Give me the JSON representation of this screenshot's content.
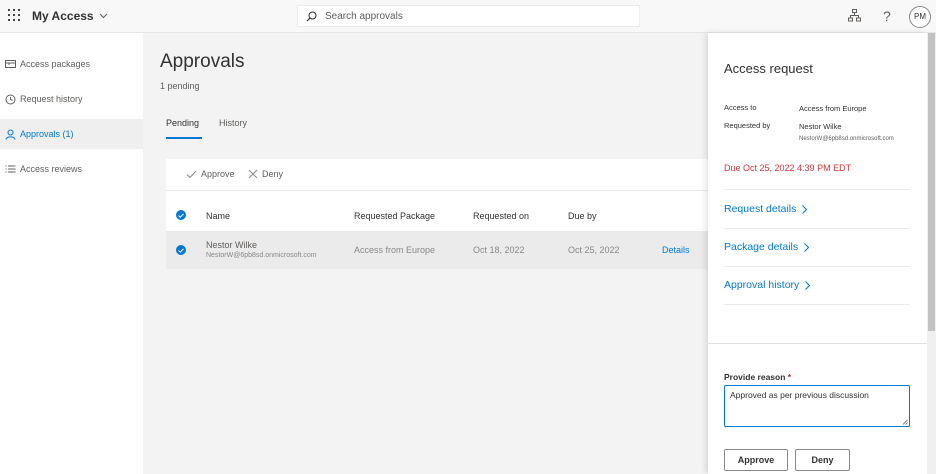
{
  "topbar": {
    "waffle_icon": "waffle-icon",
    "app_title": "My Access",
    "search_placeholder": "Search approvals",
    "org_icon": "org-chart-icon",
    "help_label": "?",
    "avatar_initials": "PM"
  },
  "sidebar": {
    "items": [
      {
        "label": "Access packages",
        "icon": "package-icon",
        "active": false
      },
      {
        "label": "Request history",
        "icon": "history-icon",
        "active": false
      },
      {
        "label": "Approvals (1)",
        "icon": "person-icon",
        "active": true
      },
      {
        "label": "Access reviews",
        "icon": "list-icon",
        "active": false
      }
    ]
  },
  "main": {
    "title": "Approvals",
    "subtitle": "1 pending",
    "tabs": [
      {
        "label": "Pending",
        "active": true
      },
      {
        "label": "History",
        "active": false
      }
    ],
    "commands": {
      "approve": "Approve",
      "deny": "Deny"
    },
    "columns": [
      "Name",
      "Requested Package",
      "Requested on",
      "Due by"
    ],
    "rows": [
      {
        "name": "Nestor Wilke",
        "email": "NestorW@6pb8sd.onmicrosoft.com",
        "package": "Access from Europe",
        "requested_on": "Oct 18, 2022",
        "due_by": "Oct 25, 2022",
        "action": "Details",
        "selected": true
      }
    ]
  },
  "panel": {
    "title": "Access request",
    "access_to_label": "Access to",
    "access_to_value": "Access from Europe",
    "requested_by_label": "Requested by",
    "requested_by_name": "Nestor Wilke",
    "requested_by_email": "NestorW@6pb8sd.onmicrosoft.com",
    "due": "Due Oct 25, 2022 4:39 PM EDT",
    "links": [
      "Request details",
      "Package details",
      "Approval history"
    ],
    "reason_label": "Provide reason",
    "reason_required_mark": "*",
    "reason_value": "Approved as per previous discussion",
    "approve_label": "Approve",
    "deny_label": "Deny"
  },
  "colors": {
    "accent": "#0078d4",
    "due_text": "#d13438",
    "required_mark": "#a4262c"
  }
}
